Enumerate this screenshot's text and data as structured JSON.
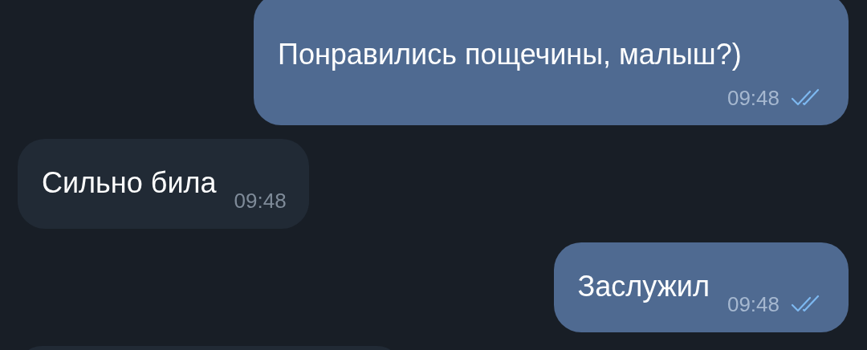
{
  "messages": [
    {
      "outgoing": true,
      "wide": true,
      "kind": "text",
      "text": "Понравились пощечины, малыш?)",
      "time": "09:48",
      "read": true
    },
    {
      "outgoing": false,
      "wide": false,
      "kind": "text",
      "text": "Сильно била",
      "time": "09:48"
    },
    {
      "outgoing": true,
      "wide": false,
      "kind": "text",
      "text": "Заслужил",
      "time": "09:48",
      "read": true
    },
    {
      "outgoing": false,
      "kind": "cut"
    }
  ]
}
